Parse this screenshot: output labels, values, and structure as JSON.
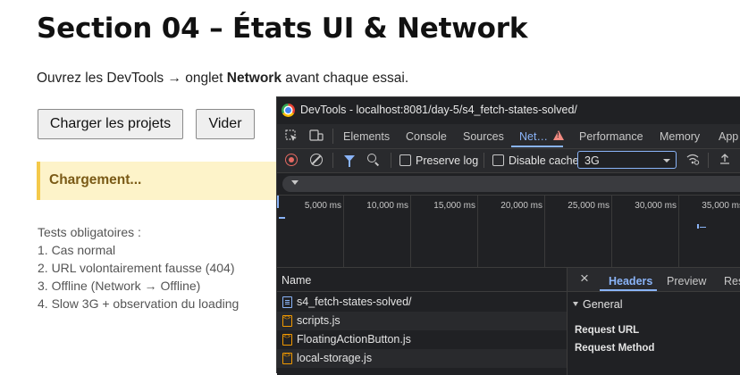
{
  "page": {
    "title": "Section 04 – États UI & Network",
    "intro_prefix": "Ouvrez les DevTools → onglet ",
    "intro_bold": "Network",
    "intro_suffix": " avant chaque essai.",
    "load_button": "Charger les projets",
    "clear_button": "Vider",
    "loading_text": "Chargement...",
    "tests": [
      "Tests obligatoires :",
      "1. Cas normal",
      "2. URL volontairement fausse (404)",
      "3. Offline (Network → Offline)",
      "4. Slow 3G + observation du loading"
    ]
  },
  "devtools": {
    "window_title": "DevTools - localhost:8081/day-5/s4_fetch-states-solved/",
    "tabs": [
      "Elements",
      "Console",
      "Sources",
      "Net…",
      "Performance",
      "Memory",
      "App"
    ],
    "active_tab": "Net…",
    "toolbar": {
      "preserve_log": "Preserve log",
      "disable_cache": "Disable cache",
      "throttling": "3G"
    },
    "timeline_ticks": [
      "5,000 ms",
      "10,000 ms",
      "15,000 ms",
      "20,000 ms",
      "25,000 ms",
      "30,000 ms",
      "35,000 ms"
    ],
    "list_header": "Name",
    "requests": [
      {
        "name": "s4_fetch-states-solved/",
        "type": "doc"
      },
      {
        "name": "scripts.js",
        "type": "js"
      },
      {
        "name": "FloatingActionButton.js",
        "type": "js"
      },
      {
        "name": "local-storage.js",
        "type": "js"
      }
    ],
    "details": {
      "tabs": [
        "Headers",
        "Preview",
        "Resp"
      ],
      "active_tab": "Headers",
      "section": "General",
      "keys": [
        "Request URL",
        "Request Method"
      ]
    },
    "colors": {
      "accent": "#8ab4f8",
      "record": "#e46962",
      "warning": "#f28b82",
      "background": "#202124"
    }
  }
}
